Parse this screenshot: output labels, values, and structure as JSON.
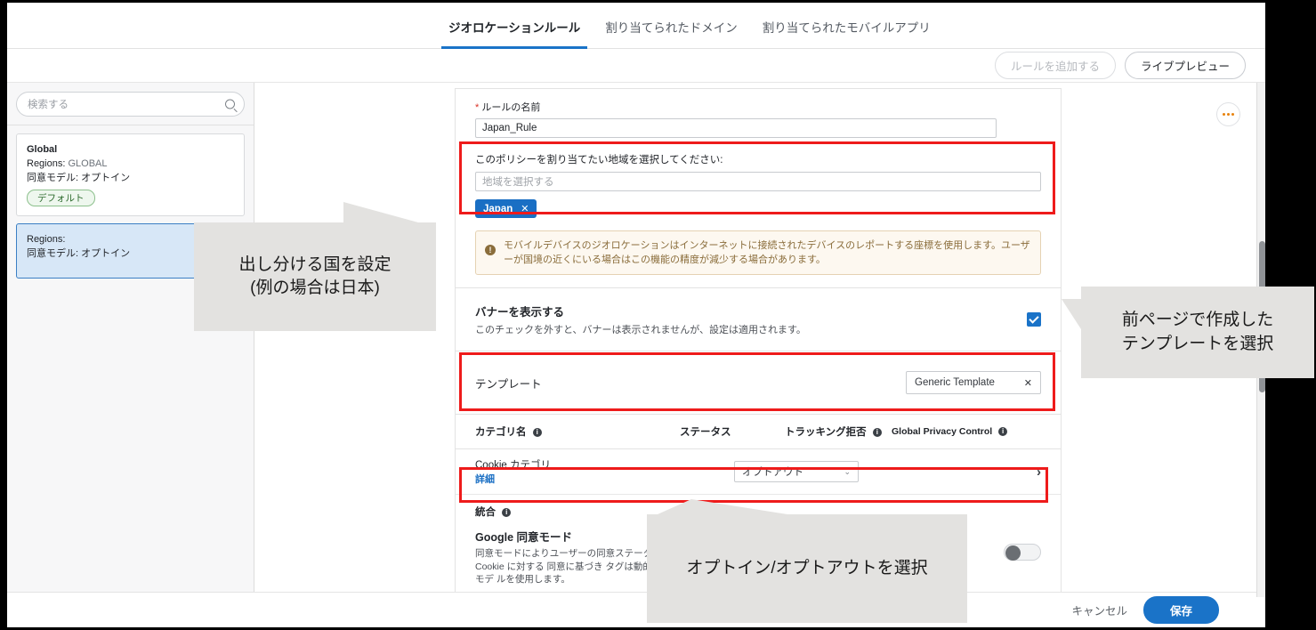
{
  "tabs": [
    {
      "label": "ジオロケーションルール",
      "active": true
    },
    {
      "label": "割り当てられたドメイン",
      "active": false
    },
    {
      "label": "割り当てられたモバイルアプリ",
      "active": false
    }
  ],
  "actionbar": {
    "add_rule_label": "ルールを追加する",
    "live_preview_label": "ライブプレビュー"
  },
  "sidebar": {
    "search_placeholder": "検索する",
    "cards": [
      {
        "title": "Global",
        "regions_label": "Regions:",
        "regions_value": "GLOBAL",
        "consent_label": "同意モデル:",
        "consent_value": "オプトイン",
        "badge": "デフォルト",
        "selected": false
      },
      {
        "title": "",
        "regions_label": "Regions:",
        "regions_value": "",
        "consent_label": "同意モデル:",
        "consent_value": "オプトイン",
        "badge": "",
        "selected": true
      }
    ]
  },
  "form": {
    "rule_name_label": "ルールの名前",
    "rule_name_required_mark": "*",
    "rule_name_value": "Japan_Rule",
    "overflow_menu": "...",
    "geo_label": "このポリシーを割り当てたい地域を選択してください:",
    "geo_placeholder": "地域を選択する",
    "geo_chip": "Japan",
    "geo_chip_remove": "✕",
    "notice_icon": "!",
    "notice_text": "モバイルデバイスのジオロケーションはインターネットに接続されたデバイスのレポートする座標を使用します。ユーザーが国境の近くにいる場合はこの機能の精度が減少する場合があります。",
    "banner_title": "バナーを表示する",
    "banner_sub": "このチェックを外すと、バナーは表示されませんが、設定は適用されます。",
    "banner_checked": true,
    "template_label": "テンプレート",
    "template_value": "Generic Template",
    "template_clear": "✕"
  },
  "table": {
    "headers": {
      "category": "カテゴリ名",
      "status": "ステータス",
      "tracking": "トラッキング拒否",
      "gpc": "Global Privacy Control"
    },
    "rows": [
      {
        "name": "Cookie カテゴリ",
        "detail_link": "詳細",
        "status_value": "オプトアウト",
        "chevron": "›"
      }
    ]
  },
  "integrations": {
    "title": "統合",
    "gcm_title": "Google 同意モード",
    "gcm_body": "同意モードによりユーザーの同意ステータス を受け取りま す。アナリティクスと広告 Cookie に対する 同意に基づき タグは動的に適応し、ユーザーの同意が得ら れない場合はモデ ルを使用します。",
    "toggle_on": false
  },
  "footer": {
    "cancel_label": "キャンセル",
    "save_label": "保存"
  },
  "annotations": {
    "region": "出し分ける国を設定\n(例の場合は日本)",
    "region_line1": "出し分ける国を設定",
    "region_line2": "(例の場合は日本)",
    "template_line1": "前ページで作成した",
    "template_line2": "テンプレートを選択",
    "optin": "オプトイン/オプトアウトを選択"
  },
  "colors": {
    "accent": "#1a73c8",
    "highlight": "#ee1b1b",
    "selected_card": "#d7e7f7",
    "notice": "#8a6d3b"
  }
}
